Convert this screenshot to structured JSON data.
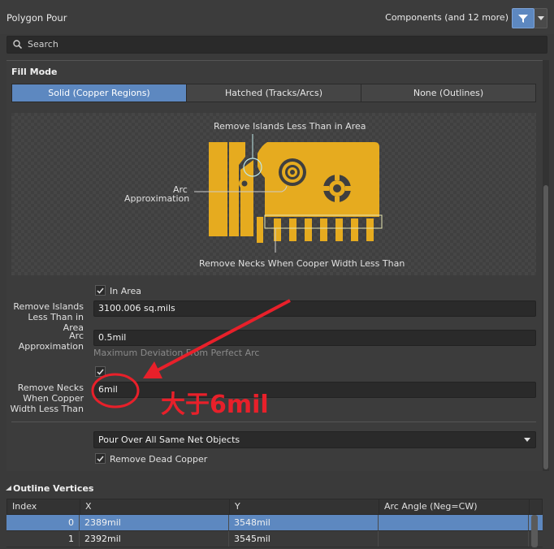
{
  "header": {
    "title": "Polygon Pour",
    "components_label": "Components (and 12 more)"
  },
  "search": {
    "placeholder": "Search"
  },
  "fill_mode": {
    "heading": "Fill Mode",
    "options": [
      "Solid (Copper Regions)",
      "Hatched (Tracks/Arcs)",
      "None (Outlines)"
    ],
    "selected": "Solid (Copper Regions)"
  },
  "preview": {
    "label_islands": "Remove Islands Less Than in Area",
    "label_arc_1": "Arc",
    "label_arc_2": "Approximation",
    "label_necks": "Remove Necks When Cooper Width Less Than",
    "copper_color": "#e6ab1f"
  },
  "form": {
    "in_area_label": "In Area",
    "in_area_checked": true,
    "islands_label_1": "Remove Islands",
    "islands_label_2": "Less Than in Area",
    "islands_value": "3100.006 sq.mils",
    "arc_label_1": "Arc",
    "arc_label_2": "Approximation",
    "arc_value": "0.5mil",
    "arc_hint": "Maximum Deviation From Perfect Arc",
    "necks_checked": true,
    "necks_label_1": "Remove Necks",
    "necks_label_2": "When Copper",
    "necks_label_3": "Width Less Than",
    "necks_value": "6mil",
    "pour_over_value": "Pour Over All Same Net Objects",
    "remove_dead_label": "Remove Dead Copper",
    "remove_dead_checked": true
  },
  "annotation": {
    "text": "大于6mil",
    "color": "#e8202a"
  },
  "outline_vertices": {
    "heading": "Outline Vertices",
    "columns": [
      "Index",
      "X",
      "Y",
      "Arc Angle (Neg=CW)"
    ],
    "rows": [
      {
        "index": "0",
        "x": "2389mil",
        "y": "3548mil",
        "arc": ""
      },
      {
        "index": "1",
        "x": "2392mil",
        "y": "3545mil",
        "arc": ""
      }
    ],
    "selected_row": 0
  },
  "colors": {
    "accent": "#5d88c0",
    "panel": "#3c3c3c",
    "field": "#2a2a2a"
  }
}
